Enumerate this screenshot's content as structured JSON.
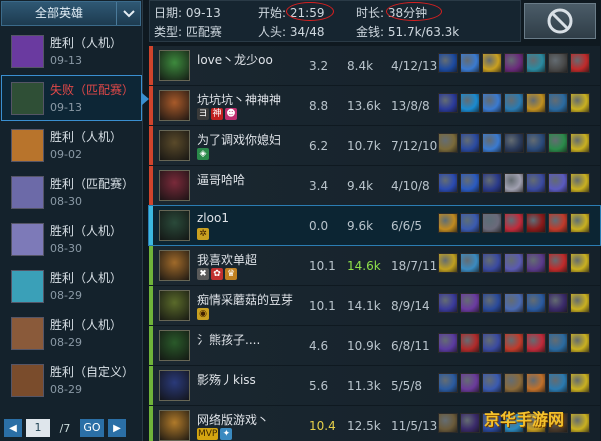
{
  "sidebar": {
    "title": "全部英雄",
    "items": [
      {
        "result": "胜利（人机）",
        "date": "09-13",
        "lose": false,
        "selected": false,
        "color": "#6a3aa0"
      },
      {
        "result": "失败（匹配赛）",
        "date": "09-13",
        "lose": true,
        "selected": true,
        "color": "#2f4f36"
      },
      {
        "result": "胜利（人机）",
        "date": "09-02",
        "lose": false,
        "selected": false,
        "color": "#b8742c"
      },
      {
        "result": "胜利（匹配赛）",
        "date": "08-30",
        "lose": false,
        "selected": false,
        "color": "#6c6aa8"
      },
      {
        "result": "胜利（人机）",
        "date": "08-30",
        "lose": false,
        "selected": false,
        "color": "#7d7ab8"
      },
      {
        "result": "胜利（人机）",
        "date": "08-29",
        "lose": false,
        "selected": false,
        "color": "#3aa0b8"
      },
      {
        "result": "胜利（人机）",
        "date": "08-29",
        "lose": false,
        "selected": false,
        "color": "#8a5a3a"
      },
      {
        "result": "胜利（自定义）",
        "date": "08-29",
        "lose": false,
        "selected": false,
        "color": "#7a4c2c"
      }
    ]
  },
  "pager": {
    "prev": "◀",
    "page": "1",
    "total": "/7",
    "go": "GO",
    "next": "▶"
  },
  "info": {
    "date_label": "日期:",
    "date": "09-13",
    "start_label": "开始:",
    "start": "21:59",
    "duration_label": "时长:",
    "duration": "38分钟",
    "type_label": "类型:",
    "type": "匹配赛",
    "heads_label": "人头:",
    "heads": "34/48",
    "gold_label": "金钱:",
    "gold": "51.7k/63.3k"
  },
  "players": [
    {
      "name": "love丶龙少oo",
      "rating": "3.2",
      "gold": "8.4k",
      "kda": "4/12/13",
      "team": "red",
      "sel": false,
      "avatar": "#3d8a3d",
      "tags": [],
      "items": [
        "#1c4aa0",
        "#3a7ad0",
        "#c9a020",
        "#6a2a7a",
        "#2a8aa0",
        "#4a4a4a",
        "#c02a2a"
      ]
    },
    {
      "name": "坑坑坑丶神神神",
      "rating": "8.8",
      "gold": "13.6k",
      "kda": "13/8/8",
      "team": "red",
      "sel": false,
      "avatar": "#a85a2a",
      "tags": [
        {
          "t": "ヨ",
          "bg": "#3a3a3a",
          "c": "#fff"
        },
        {
          "t": "神",
          "bg": "#c02020",
          "c": "#fff"
        },
        {
          "t": "☻",
          "bg": "#c03070",
          "c": "#fff"
        }
      ],
      "items": [
        "#2a3a9a",
        "#1a8ad0",
        "#3a7ad0",
        "#2a7ab0",
        "#c09020",
        "#2a6aa0",
        "#c9b020"
      ]
    },
    {
      "name": "为了调戏你媳妇",
      "rating": "6.2",
      "gold": "10.7k",
      "kda": "7/12/10",
      "team": "red",
      "sel": false,
      "avatar": "#5a4a2a",
      "tags": [
        {
          "t": "◈",
          "bg": "#2a8a4a",
          "c": "#fff"
        }
      ],
      "items": [
        "#7a6a3a",
        "#2a4aa0",
        "#3a7ad0",
        "#2a3a5a",
        "#2a4a7a",
        "#2a8a4a",
        "#c9b020"
      ]
    },
    {
      "name": "逼哥哈哈",
      "rating": "3.4",
      "gold": "9.4k",
      "kda": "4/10/8",
      "team": "red",
      "sel": false,
      "avatar": "#7a2a3a",
      "tags": [],
      "items": [
        "#2a4ab0",
        "#2a5ac0",
        "#2a3a8a",
        "#a0a0b0",
        "#3a4aa0",
        "#5a5ac0",
        "#c9b020"
      ]
    },
    {
      "name": "zloo1",
      "rating": "0.0",
      "gold": "9.6k",
      "kda": "6/6/5",
      "team": "blue",
      "sel": true,
      "avatar": "#2a4a3a",
      "tags": [
        {
          "t": "✲",
          "bg": "#c9a020",
          "c": "#402000"
        }
      ],
      "items": [
        "#c08a20",
        "#3a5ab0",
        "#6a6a7a",
        "#c02a3a",
        "#8a1a1a",
        "#c03a2a",
        "#c9b020"
      ]
    },
    {
      "name": "我喜欢单超",
      "rating": "10.1",
      "gold": "14.6k",
      "kda": "18/7/11",
      "team": "green",
      "sel": false,
      "avatar": "#a06a2a",
      "tags": [
        {
          "t": "✖",
          "bg": "#5a5a5a",
          "c": "#fff"
        },
        {
          "t": "✿",
          "bg": "#c03030",
          "c": "#fff"
        },
        {
          "t": "♛",
          "bg": "#c08020",
          "c": "#fff"
        }
      ],
      "items": [
        "#c0a020",
        "#3a8ac0",
        "#3a4aa0",
        "#5a5ab0",
        "#5a3a8a",
        "#c02a2a",
        "#c9b020"
      ]
    },
    {
      "name": "痴情采蘑菇的豆芽",
      "rating": "10.1",
      "gold": "14.1k",
      "kda": "8/9/14",
      "team": "green",
      "sel": false,
      "avatar": "#5a6a2a",
      "tags": [
        {
          "t": "◉",
          "bg": "#c9a020",
          "c": "#402000"
        }
      ],
      "items": [
        "#3a3a9a",
        "#6a3aa0",
        "#2a4a9a",
        "#4a6ab0",
        "#2a5aa0",
        "#3a2a6a",
        "#c9b020"
      ]
    },
    {
      "name": "氵熊孩子....",
      "rating": "4.6",
      "gold": "10.9k",
      "kda": "6/8/11",
      "team": "green",
      "sel": false,
      "avatar": "#2a5a2a",
      "tags": [],
      "items": [
        "#5a3aa0",
        "#b02a2a",
        "#3a4aa0",
        "#c03a2a",
        "#c02a3a",
        "#2a6aa0",
        "#c9b020"
      ]
    },
    {
      "name": "影殇丿kiss",
      "rating": "5.6",
      "gold": "11.3k",
      "kda": "5/5/8",
      "team": "green",
      "sel": false,
      "avatar": "#2a3a7a",
      "tags": [],
      "items": [
        "#2a5aa0",
        "#6a3a9a",
        "#3a5ab0",
        "#8a6a3a",
        "#c0702a",
        "#2a7ab0",
        "#c9b020"
      ]
    },
    {
      "name": "网络版游戏丶",
      "rating": "10.4",
      "gold": "12.5k",
      "kda": "11/5/13",
      "team": "green",
      "sel": false,
      "avatar": "#b07a2a",
      "tags": [
        {
          "t": "MVP",
          "bg": "#d4a510",
          "c": "#3a2500"
        },
        {
          "t": "✦",
          "bg": "#3a8ac0",
          "c": "#fff"
        }
      ],
      "items": [
        "#6a5a3a",
        "#3a2a6a",
        "#2a4aa0",
        "#2a8ac0",
        "#c9a020",
        "#4a3a2a",
        "#c9b020"
      ]
    }
  ],
  "watermark": "京华手游网",
  "colors": {
    "red_team": "#d0442c",
    "blue_self": "#3cb8e0",
    "green_team": "#6fb33a",
    "accent": "#2b6fa6"
  }
}
